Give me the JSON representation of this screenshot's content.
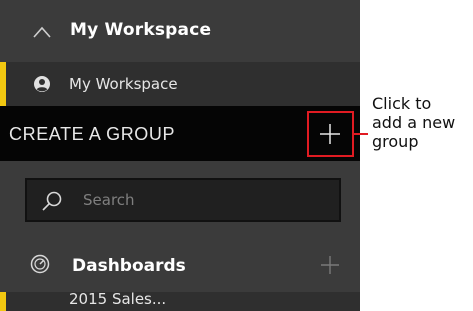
{
  "header": {
    "title": "My Workspace",
    "chevron_icon": "chevron-up-icon"
  },
  "workspace_item": {
    "label": "My Workspace",
    "icon": "user-icon",
    "accent_color": "#f2c811"
  },
  "create_group": {
    "label": "CREATE A GROUP",
    "add_icon": "plus-icon"
  },
  "search": {
    "placeholder": "Search",
    "value": "",
    "icon": "search-icon"
  },
  "dashboards": {
    "label": "Dashboards",
    "icon": "gauge-icon",
    "add_icon": "plus-icon",
    "partial_item": "2015 Sales..."
  },
  "callout": {
    "lines": [
      "Click to",
      "add a new",
      "group"
    ],
    "highlight_color": "#e11b22"
  },
  "colors": {
    "panel_bg": "#3b3b3b",
    "selected_row_bg": "#2f2f2f",
    "create_row_bg": "#050505",
    "search_bg": "#202020"
  }
}
